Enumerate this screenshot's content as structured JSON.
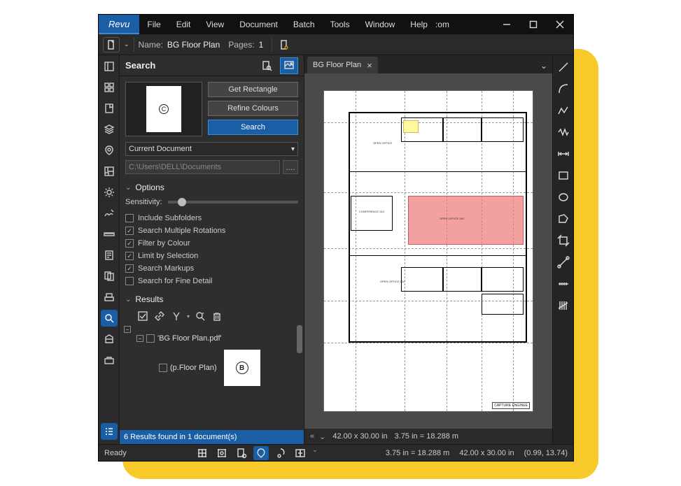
{
  "titlebar": {
    "brand": "Revu",
    "menus": [
      "File",
      "Edit",
      "View",
      "Document",
      "Batch",
      "Tools",
      "Window",
      "Help"
    ],
    "extra": ":om"
  },
  "docbar": {
    "name_label": "Name:",
    "name_value": "BG Floor Plan",
    "pages_label": "Pages:",
    "pages_value": "1"
  },
  "left_rail_icons": [
    "panel-icon",
    "thumbnails-icon",
    "bookmarks-icon",
    "layers-icon",
    "places-icon",
    "spaces-icon",
    "settings-icon",
    "signatures-icon",
    "measure-icon",
    "forms-icon",
    "compare-icon",
    "scanner-icon",
    "search-icon",
    "sets-icon",
    "toolchest-icon",
    "list-icon"
  ],
  "panel": {
    "title": "Search",
    "modes": [
      "text-search-icon",
      "visual-search-icon"
    ],
    "thumb_letter": "C",
    "buttons": {
      "get_rect": "Get Rectangle",
      "refine": "Refine Colours",
      "search": "Search"
    },
    "scope_selected": "Current Document",
    "path_value": "C:\\Users\\DELL\\Documents",
    "path_more": "....",
    "options_title": "Options",
    "sensitivity_label": "Sensitivity:",
    "checks": {
      "include_subfolders": {
        "label": "Include Subfolders",
        "checked": false
      },
      "multiple_rotations": {
        "label": "Search Multiple Rotations",
        "checked": true
      },
      "filter_colour": {
        "label": "Filter by Colour",
        "checked": true
      },
      "limit_selection": {
        "label": "Limit by Selection",
        "checked": true
      },
      "search_markups": {
        "label": "Search Markups",
        "checked": true
      },
      "fine_detail": {
        "label": "Search for Fine Detail",
        "checked": false
      }
    },
    "results_title": "Results",
    "tree": {
      "file": "'BG Floor Plan.pdf'",
      "page_label": "(p.Floor Plan)",
      "page_thumb_letter": "B"
    },
    "status": "6 Results found in 1 document(s)"
  },
  "doc": {
    "tab_title": "BG Floor Plan",
    "footer_text": "CAPTURE ENGINEE",
    "status": {
      "dim1": "42.00 x 30.00 in",
      "dim2": "3.75 in = 18.288 m"
    }
  },
  "right_rail_icons": [
    "line-icon",
    "arc-icon",
    "polyline-icon",
    "zigzag-icon",
    "dimension-icon",
    "rectangle-icon",
    "ellipse-icon",
    "polygon-icon",
    "crop-icon",
    "calibrate-icon",
    "ruler-h-icon",
    "count-icon"
  ],
  "appstatus": {
    "ready": "Ready",
    "dim2": "3.75 in = 18.288 m",
    "dim1": "42.00 x 30.00 in",
    "cursor": "(0.99, 13.74)"
  }
}
